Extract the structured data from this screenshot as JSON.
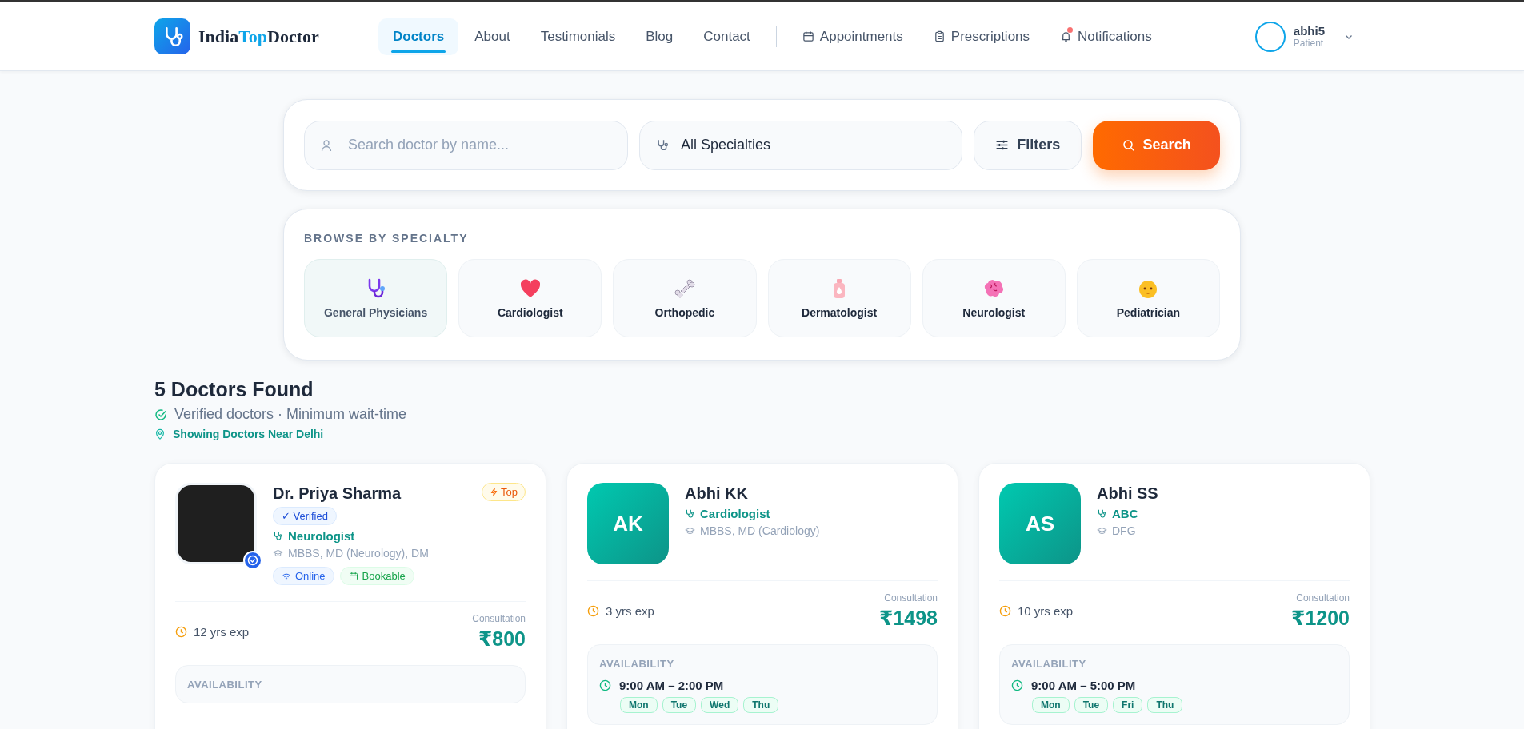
{
  "header": {
    "logo": [
      {
        "text": "India",
        "highlight": false
      },
      {
        "text": "Top",
        "highlight": true
      },
      {
        "text": "Doctor",
        "highlight": false
      }
    ],
    "nav": [
      {
        "label": "Doctors",
        "selected": true
      },
      {
        "label": "About",
        "selected": false
      },
      {
        "label": "Testimonials",
        "selected": false
      },
      {
        "label": "Blog",
        "selected": false
      },
      {
        "label": "Contact",
        "selected": false
      }
    ],
    "quick_links": [
      {
        "label": "Appointments",
        "unread": false
      },
      {
        "label": "Prescriptions",
        "unread": false
      },
      {
        "label": "Notifications",
        "unread": true
      }
    ],
    "user": {
      "name": "abhi5",
      "role": "Patient"
    }
  },
  "search": {
    "name_placeholder": "Search doctor by name...",
    "specialty_value": "All Specialties",
    "filters_label": "Filters",
    "search_label": "Search"
  },
  "specialties": {
    "title": "BROWSE BY SPECIALTY",
    "items": [
      {
        "label": "General Physicians",
        "selected": true
      },
      {
        "label": "Cardiologist",
        "selected": false
      },
      {
        "label": "Orthopedic",
        "selected": false
      },
      {
        "label": "Dermatologist",
        "selected": false
      },
      {
        "label": "Neurologist",
        "selected": false
      },
      {
        "label": "Pediatrician",
        "selected": false
      }
    ]
  },
  "results": {
    "title": "5 Doctors Found",
    "subtitle": "Verified doctors · Minimum wait-time",
    "location": "Showing Doctors Near Delhi"
  },
  "doctors": [
    {
      "name": "Dr. Priya Sharma",
      "avatar": {
        "kind": "photo",
        "verified": true
      },
      "top_badge": "Top",
      "verified_label": "✓ Verified",
      "specialty": "Neurologist",
      "degrees": "MBBS, MD (Neurology), DM",
      "tags": [
        {
          "kind": "online",
          "label": "Online"
        },
        {
          "kind": "bookable",
          "label": "Bookable"
        }
      ],
      "experience": "12 yrs exp",
      "fee_label": "Consultation",
      "fee": "₹800",
      "availability": {
        "title": "AVAILABILITY"
      }
    },
    {
      "name": "Abhi KK",
      "avatar": {
        "kind": "initials",
        "initials": "AK"
      },
      "specialty": "Cardiologist",
      "degrees": "MBBS, MD (Cardiology)",
      "experience": "3 yrs exp",
      "fee_label": "Consultation",
      "fee": "₹1498",
      "availability": {
        "title": "AVAILABILITY",
        "hours": "9:00 AM – 2:00 PM",
        "days": [
          "Mon",
          "Tue",
          "Wed",
          "Thu"
        ]
      }
    },
    {
      "name": "Abhi SS",
      "avatar": {
        "kind": "initials",
        "initials": "AS"
      },
      "specialty": "ABC",
      "degrees": "DFG",
      "experience": "10 yrs exp",
      "fee_label": "Consultation",
      "fee": "₹1200",
      "availability": {
        "title": "AVAILABILITY",
        "hours": "9:00 AM – 5:00 PM",
        "days": [
          "Mon",
          "Tue",
          "Fri",
          "Thu"
        ]
      }
    }
  ]
}
